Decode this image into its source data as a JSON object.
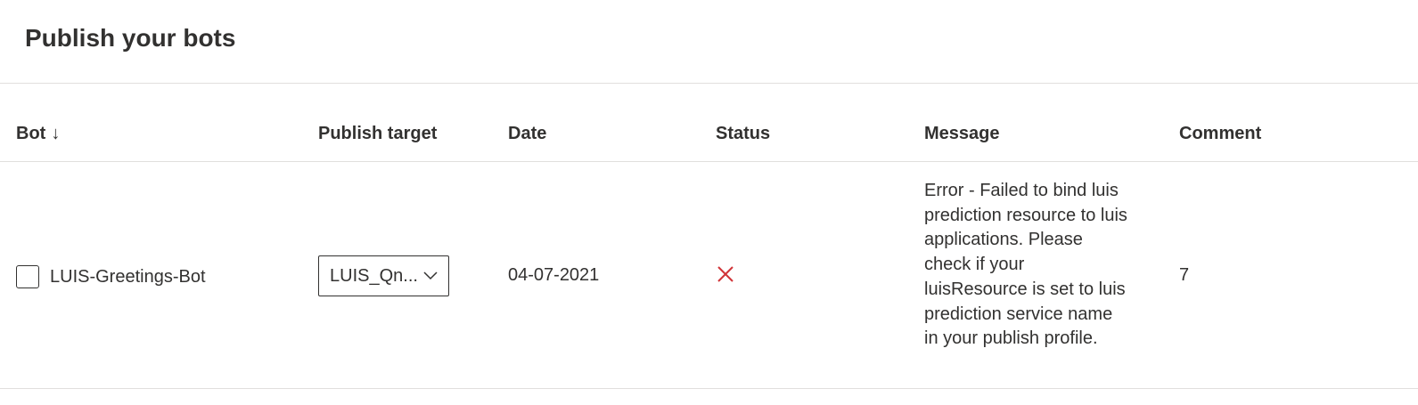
{
  "page": {
    "title": "Publish your bots"
  },
  "table": {
    "columns": {
      "bot": "Bot",
      "publish_target": "Publish target",
      "date": "Date",
      "status": "Status",
      "message": "Message",
      "comment": "Comment"
    },
    "sort_icon": "arrow-down-icon",
    "rows": [
      {
        "bot": "LUIS-Greetings-Bot",
        "checked": false,
        "publish_target": "LUIS_Qn...",
        "date": "04-07-2021",
        "status_icon": "error-x-icon",
        "status_color": "#d13438",
        "message": "Error - Failed to bind luis prediction resource to luis applications. Please check if your luisResource is set to luis prediction service name in your publish profile.",
        "comment": "7"
      }
    ]
  }
}
